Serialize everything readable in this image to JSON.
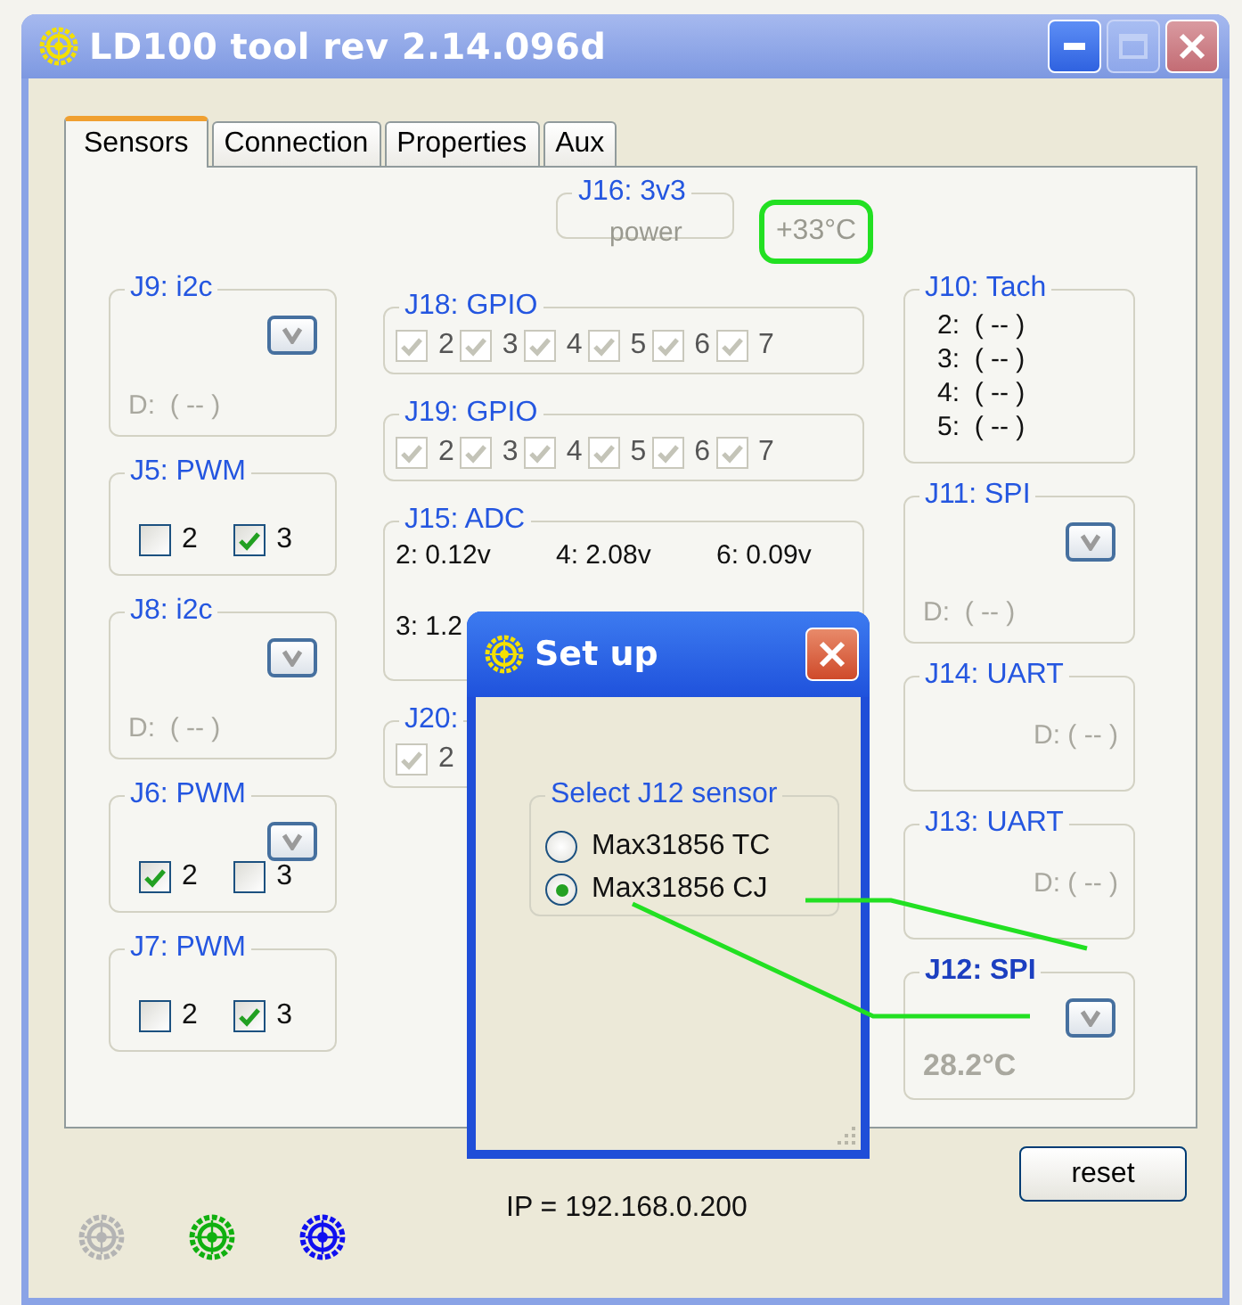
{
  "window": {
    "title": "LD100 tool rev 2.14.096d"
  },
  "tabs": [
    {
      "label": "Sensors",
      "selected": true
    },
    {
      "label": "Connection",
      "selected": false
    },
    {
      "label": "Properties",
      "selected": false
    },
    {
      "label": "Aux",
      "selected": false
    }
  ],
  "power_group": {
    "title": "J16: 3v3",
    "label": "power",
    "temperature": "+33°C"
  },
  "left_groups": [
    {
      "kind": "readout",
      "title": "J9: i2c",
      "menu": true,
      "emphasized": false,
      "value": "D:  ( -- )"
    },
    {
      "kind": "pwm",
      "title": "J5: PWM",
      "menu": false,
      "checks": [
        {
          "label": "2",
          "checked": false,
          "disabled": false
        },
        {
          "label": "3",
          "checked": true,
          "disabled": false
        }
      ]
    },
    {
      "kind": "readout",
      "title": "J8: i2c",
      "menu": true,
      "emphasized": false,
      "value": "D:  ( -- )"
    },
    {
      "kind": "pwm",
      "title": "J6: PWM",
      "menu": true,
      "checks": [
        {
          "label": "2",
          "checked": true,
          "disabled": false
        },
        {
          "label": "3",
          "checked": false,
          "disabled": false
        }
      ]
    },
    {
      "kind": "pwm",
      "title": "J7: PWM",
      "menu": false,
      "checks": [
        {
          "label": "2",
          "checked": false,
          "disabled": false
        },
        {
          "label": "3",
          "checked": true,
          "disabled": false
        }
      ]
    }
  ],
  "middle_groups": [
    {
      "kind": "gpio",
      "title": "J18: GPIO",
      "checks": [
        {
          "label": "2",
          "checked": true,
          "disabled": true
        },
        {
          "label": "3",
          "checked": true,
          "disabled": true
        },
        {
          "label": "4",
          "checked": true,
          "disabled": true
        },
        {
          "label": "5",
          "checked": true,
          "disabled": true
        },
        {
          "label": "6",
          "checked": true,
          "disabled": true
        },
        {
          "label": "7",
          "checked": true,
          "disabled": true
        }
      ]
    },
    {
      "kind": "gpio",
      "title": "J19: GPIO",
      "checks": [
        {
          "label": "2",
          "checked": true,
          "disabled": true
        },
        {
          "label": "3",
          "checked": true,
          "disabled": true
        },
        {
          "label": "4",
          "checked": true,
          "disabled": true
        },
        {
          "label": "5",
          "checked": true,
          "disabled": true
        },
        {
          "label": "6",
          "checked": true,
          "disabled": true
        },
        {
          "label": "7",
          "checked": true,
          "disabled": true
        }
      ]
    },
    {
      "kind": "adc",
      "title": "J15: ADC",
      "rows": [
        [
          "2: 0.12v",
          "4: 2.08v",
          "6: 0.09v"
        ],
        [
          "3: 1.2"
        ]
      ]
    },
    {
      "kind": "gpio",
      "title": "J20:",
      "checks": [
        {
          "label": "2",
          "checked": true,
          "disabled": true
        }
      ]
    }
  ],
  "right_groups": [
    {
      "kind": "tach",
      "title": "J10: Tach",
      "lines": [
        "2:  ( -- )",
        "3:  ( -- )",
        "4:  ( -- )",
        "5:  ( -- )"
      ]
    },
    {
      "kind": "readout",
      "title": "J11: SPI",
      "menu": true,
      "emphasized": false,
      "value": "D:  ( -- )"
    },
    {
      "kind": "uart",
      "title": "J14: UART",
      "value": "D: ( -- )"
    },
    {
      "kind": "uart",
      "title": "J13: UART",
      "value": "D: ( -- )"
    },
    {
      "kind": "readout",
      "title": "J12: SPI",
      "menu": true,
      "emphasized": true,
      "value": "28.2°C"
    }
  ],
  "dialog": {
    "title": "Set up",
    "group_title": "Select J12 sensor",
    "options": [
      {
        "label": "Max31856 TC",
        "selected": false
      },
      {
        "label": "Max31856 CJ",
        "selected": true
      }
    ]
  },
  "status_indicators": [
    {
      "color": "#b4b4b4"
    },
    {
      "color": "#10b010"
    },
    {
      "color": "#1010f0"
    }
  ],
  "ip": "IP = 192.168.0.200",
  "reset_button": "reset"
}
